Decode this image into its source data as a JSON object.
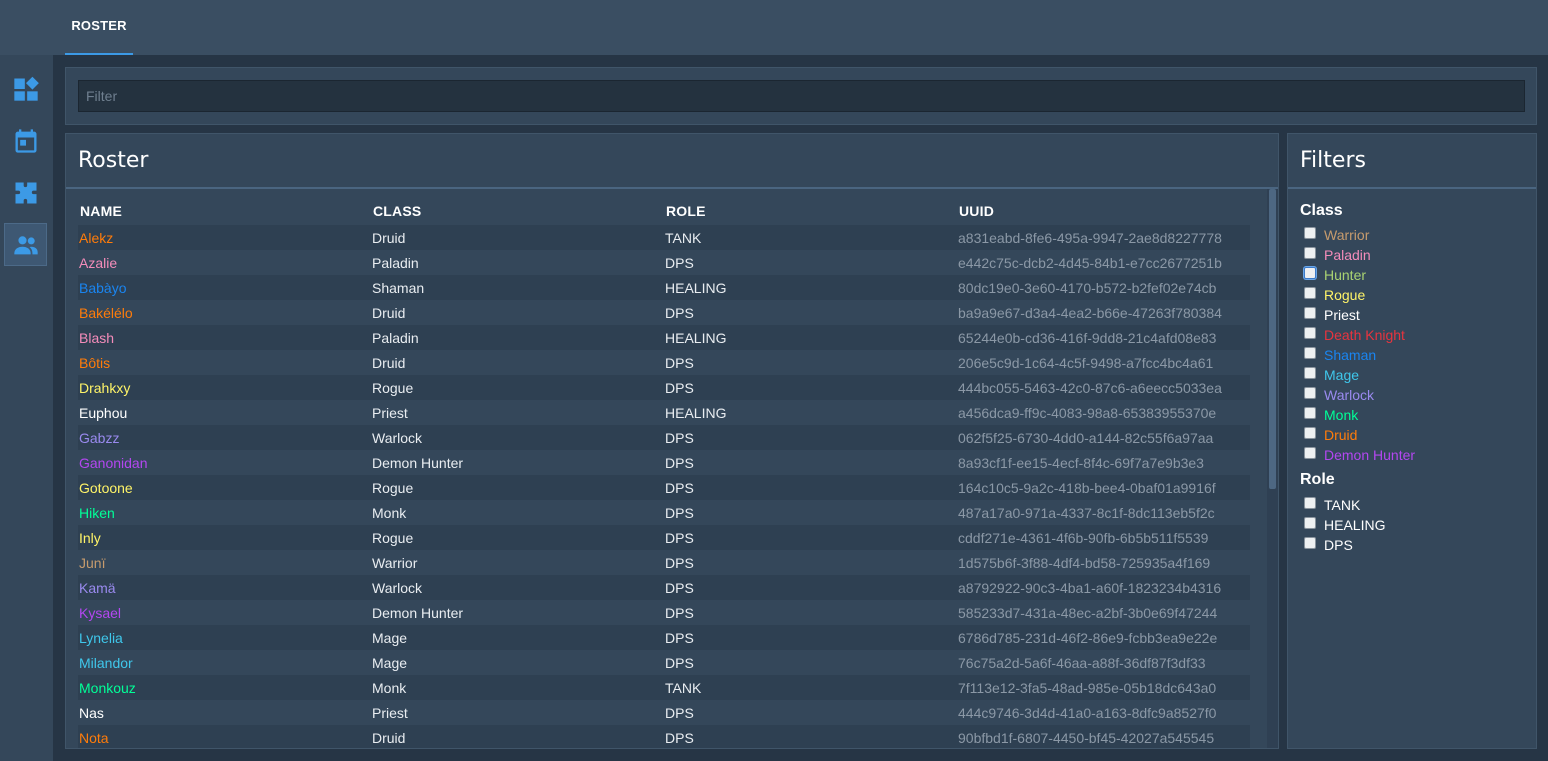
{
  "topbar": {
    "tab_label": "ROSTER"
  },
  "sidebar": {
    "items": [
      {
        "icon": "dashboard-icon"
      },
      {
        "icon": "calendar-icon"
      },
      {
        "icon": "puzzle-icon"
      },
      {
        "icon": "people-icon"
      }
    ]
  },
  "filter": {
    "placeholder": "Filter",
    "value": ""
  },
  "roster": {
    "title": "Roster",
    "columns": [
      "NAME",
      "CLASS",
      "ROLE",
      "UUID"
    ],
    "rows": [
      {
        "name": "Alekz",
        "class": "Druid",
        "role": "TANK",
        "uuid": "a831eabd-8fe6-495a-9947-2ae8d8227778"
      },
      {
        "name": "Azalie",
        "class": "Paladin",
        "role": "DPS",
        "uuid": "e442c75c-dcb2-4d45-84b1-e7cc2677251b"
      },
      {
        "name": "Babàyo",
        "class": "Shaman",
        "role": "HEALING",
        "uuid": "80dc19e0-3e60-4170-b572-b2fef02e74cb"
      },
      {
        "name": "Bakélélo",
        "class": "Druid",
        "role": "DPS",
        "uuid": "ba9a9e67-d3a4-4ea2-b66e-47263f780384"
      },
      {
        "name": "Blash",
        "class": "Paladin",
        "role": "HEALING",
        "uuid": "65244e0b-cd36-416f-9dd8-21c4afd08e83"
      },
      {
        "name": "Bôtis",
        "class": "Druid",
        "role": "DPS",
        "uuid": "206e5c9d-1c64-4c5f-9498-a7fcc4bc4a61"
      },
      {
        "name": "Drahkxy",
        "class": "Rogue",
        "role": "DPS",
        "uuid": "444bc055-5463-42c0-87c6-a6eecc5033ea"
      },
      {
        "name": "Euphou",
        "class": "Priest",
        "role": "HEALING",
        "uuid": "a456dca9-ff9c-4083-98a8-65383955370e"
      },
      {
        "name": "Gabzz",
        "class": "Warlock",
        "role": "DPS",
        "uuid": "062f5f25-6730-4dd0-a144-82c55f6a97aa"
      },
      {
        "name": "Ganonidan",
        "class": "Demon Hunter",
        "role": "DPS",
        "uuid": "8a93cf1f-ee15-4ecf-8f4c-69f7a7e9b3e3"
      },
      {
        "name": "Gotoone",
        "class": "Rogue",
        "role": "DPS",
        "uuid": "164c10c5-9a2c-418b-bee4-0baf01a9916f"
      },
      {
        "name": "Hiken",
        "class": "Monk",
        "role": "DPS",
        "uuid": "487a17a0-971a-4337-8c1f-8dc113eb5f2c"
      },
      {
        "name": "Inly",
        "class": "Rogue",
        "role": "DPS",
        "uuid": "cddf271e-4361-4f6b-90fb-6b5b511f5539"
      },
      {
        "name": "Junï",
        "class": "Warrior",
        "role": "DPS",
        "uuid": "1d575b6f-3f88-4df4-bd58-725935a4f169"
      },
      {
        "name": "Kamä",
        "class": "Warlock",
        "role": "DPS",
        "uuid": "a8792922-90c3-4ba1-a60f-1823234b4316"
      },
      {
        "name": "Kysael",
        "class": "Demon Hunter",
        "role": "DPS",
        "uuid": "585233d7-431a-48ec-a2bf-3b0e69f47244"
      },
      {
        "name": "Lynelia",
        "class": "Mage",
        "role": "DPS",
        "uuid": "6786d785-231d-46f2-86e9-fcbb3ea9e22e"
      },
      {
        "name": "Milandor",
        "class": "Mage",
        "role": "DPS",
        "uuid": "76c75a2d-5a6f-46aa-a88f-36df87f3df33"
      },
      {
        "name": "Monkouz",
        "class": "Monk",
        "role": "TANK",
        "uuid": "7f113e12-3fa5-48ad-985e-05b18dc643a0"
      },
      {
        "name": "Nas",
        "class": "Priest",
        "role": "DPS",
        "uuid": "444c9746-3d4d-41a0-a163-8dfc9a8527f0"
      },
      {
        "name": "Nota",
        "class": "Druid",
        "role": "DPS",
        "uuid": "90bfbd1f-6807-4450-bf45-42027a545545"
      }
    ]
  },
  "filters": {
    "title": "Filters",
    "class_heading": "Class",
    "classes": [
      {
        "label": "Warrior",
        "checked": false
      },
      {
        "label": "Paladin",
        "checked": false
      },
      {
        "label": "Hunter",
        "checked": false
      },
      {
        "label": "Rogue",
        "checked": false
      },
      {
        "label": "Priest",
        "checked": false
      },
      {
        "label": "Death Knight",
        "checked": false
      },
      {
        "label": "Shaman",
        "checked": false
      },
      {
        "label": "Mage",
        "checked": false
      },
      {
        "label": "Warlock",
        "checked": false
      },
      {
        "label": "Monk",
        "checked": false
      },
      {
        "label": "Druid",
        "checked": false
      },
      {
        "label": "Demon Hunter",
        "checked": false
      }
    ],
    "role_heading": "Role",
    "roles": [
      {
        "label": "TANK",
        "checked": false
      },
      {
        "label": "HEALING",
        "checked": false
      },
      {
        "label": "DPS",
        "checked": false
      }
    ]
  },
  "colors": {
    "accent": "#3c9ae6",
    "class_colors": {
      "Warrior": "#c69b6d",
      "Paladin": "#f48cba",
      "Hunter": "#aad372",
      "Rogue": "#fff468",
      "Priest": "#ffffff",
      "Death Knight": "#e8343e",
      "Shaman": "#1a85f0",
      "Mage": "#3fc7eb",
      "Warlock": "#9a8aef",
      "Monk": "#00ff98",
      "Druid": "#ff7c0a",
      "Demon Hunter": "#b347f0"
    }
  }
}
